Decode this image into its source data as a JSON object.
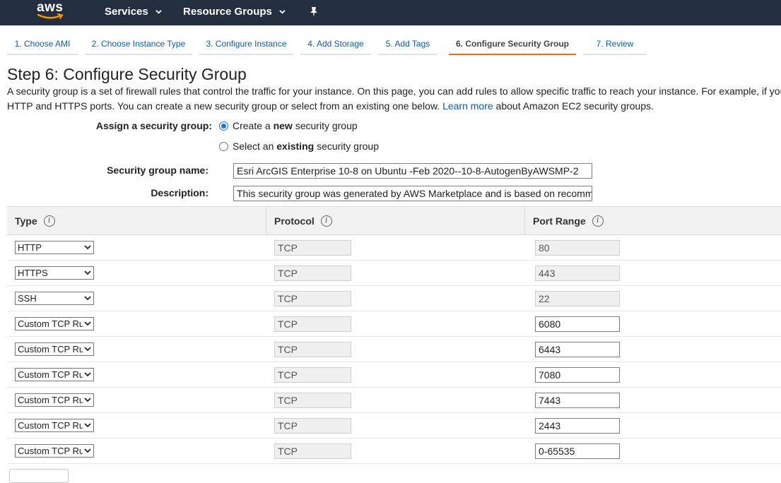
{
  "topnav": {
    "logo_text": "aws",
    "services_label": "Services",
    "resource_groups_label": "Resource Groups",
    "pin_icon": "pin-icon"
  },
  "wizard_tabs": [
    {
      "label": "1. Choose AMI"
    },
    {
      "label": "2. Choose Instance Type"
    },
    {
      "label": "3. Configure Instance"
    },
    {
      "label": "4. Add Storage"
    },
    {
      "label": "5. Add Tags"
    },
    {
      "label": "6. Configure Security Group"
    },
    {
      "label": "7. Review"
    }
  ],
  "active_tab_index": 5,
  "page": {
    "title": "Step 6: Configure Security Group",
    "intro_line1": "A security group is a set of firewall rules that control the traffic for your instance. On this page, you can add rules to allow specific traffic to reach your instance. For example, if you",
    "intro_line2_before": "HTTP and HTTPS ports. You can create a new security group or select from an existing one below.",
    "learn_more": "Learn more",
    "intro_line2_after": "about Amazon EC2 security groups."
  },
  "assign": {
    "label": "Assign a security group:",
    "option_new_pre": "Create a",
    "option_new_bold": "new",
    "option_new_post": "security group",
    "option_existing_pre": "Select an",
    "option_existing_bold": "existing",
    "option_existing_post": "security group",
    "selected": "new"
  },
  "sg_name": {
    "label": "Security group name:",
    "value": "Esri ArcGIS Enterprise 10-8 on Ubuntu -Feb 2020--10-8-AutogenByAWSMP-2"
  },
  "sg_description": {
    "label": "Description:",
    "value": "This security group was generated by AWS Marketplace and is based on recomm"
  },
  "table": {
    "col_type": "Type",
    "col_protocol": "Protocol",
    "col_port_range": "Port Range",
    "info_glyph": "i",
    "rows": [
      {
        "type": "HTTP",
        "protocol": "TCP",
        "port": "80"
      },
      {
        "type": "HTTPS",
        "protocol": "TCP",
        "port": "443"
      },
      {
        "type": "SSH",
        "protocol": "TCP",
        "port": "22"
      },
      {
        "type": "Custom TCP Rule",
        "protocol": "TCP",
        "port": "6080"
      },
      {
        "type": "Custom TCP Rule",
        "protocol": "TCP",
        "port": "6443"
      },
      {
        "type": "Custom TCP Rule",
        "protocol": "TCP",
        "port": "7080"
      },
      {
        "type": "Custom TCP Rule",
        "protocol": "TCP",
        "port": "7443"
      },
      {
        "type": "Custom TCP Rule",
        "protocol": "TCP",
        "port": "2443"
      },
      {
        "type": "Custom TCP Rule",
        "protocol": "TCP",
        "port": "0-65535"
      }
    ]
  },
  "colors": {
    "nav_bg": "#232f3e",
    "link": "#0a5fa6",
    "active_tab_underline": "#ec7211",
    "radio_selected": "#1a73e8"
  }
}
